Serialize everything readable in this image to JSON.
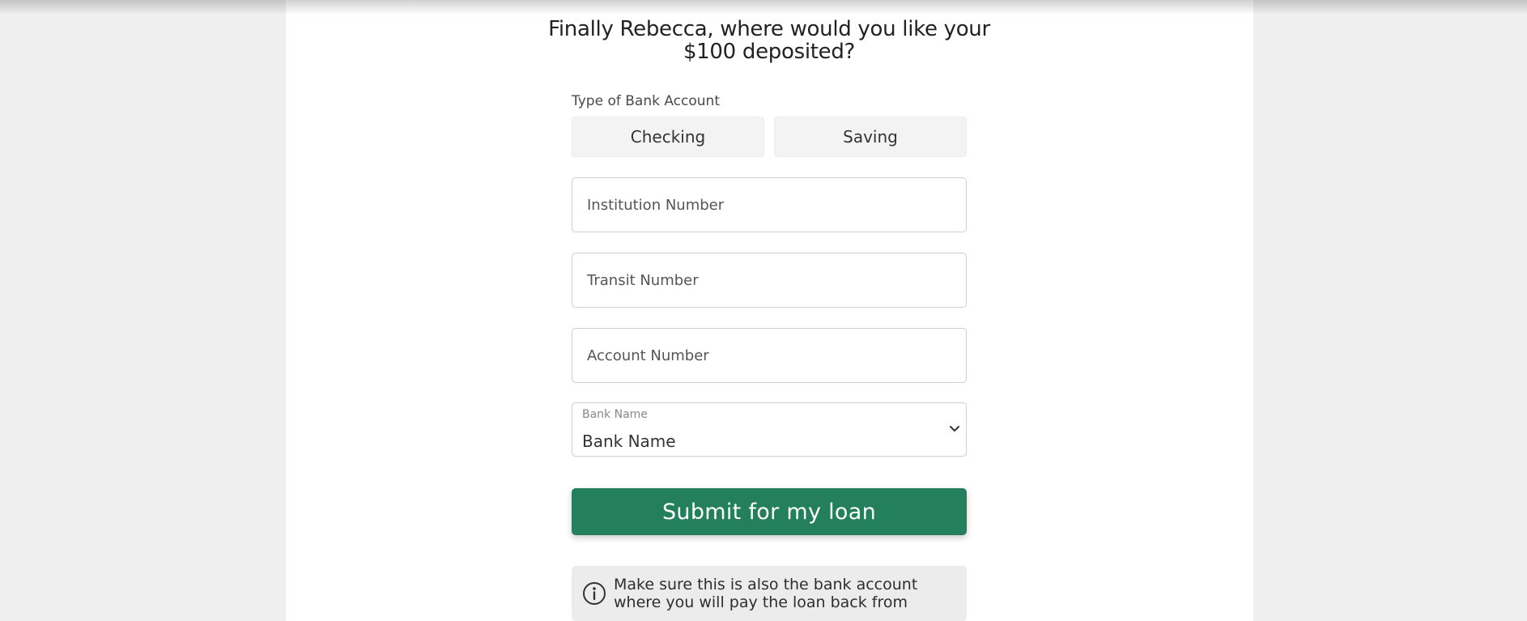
{
  "heading": "Finally Rebecca, where would you like your $100 deposited?",
  "account_type": {
    "label": "Type of Bank Account",
    "options": [
      "Checking",
      "Saving"
    ]
  },
  "fields": {
    "institution_placeholder": "Institution Number",
    "transit_placeholder": "Transit Number",
    "account_placeholder": "Account Number"
  },
  "bank_select": {
    "label": "Bank Name",
    "selected": "Bank Name"
  },
  "submit_label": "Submit for my loan",
  "info_note": "Make sure this is also the bank account where you will pay the loan back from",
  "colors": {
    "primary": "#247f5d",
    "page_bg": "#efefef",
    "card_bg": "#ffffff"
  },
  "icons": {
    "info": "info-circle-icon",
    "chevron": "chevron-down-icon"
  }
}
